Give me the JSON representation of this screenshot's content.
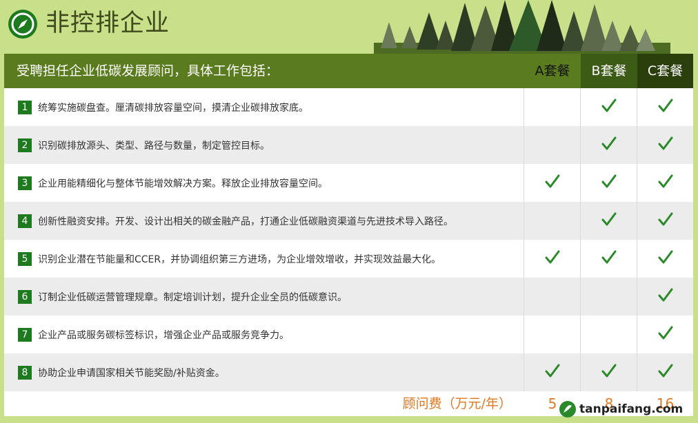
{
  "header": {
    "title": "非控排企业",
    "logo": "compass-icon"
  },
  "table": {
    "intro": "受聘担任企业低碳发展顾问，具体工作包括：",
    "packages": [
      "A套餐",
      "B套餐",
      "C套餐"
    ],
    "rows": [
      {
        "num": "1",
        "text": "统筹实施碳盘查。厘清碳排放容量空间，摸清企业碳排放家底。",
        "a": false,
        "b": true,
        "c": true
      },
      {
        "num": "2",
        "text": "识别碳排放源头、类型、路径与数量，制定管控目标。",
        "a": false,
        "b": true,
        "c": true
      },
      {
        "num": "3",
        "text": "企业用能精细化与整体节能增效解决方案。释放企业排放容量空间。",
        "a": true,
        "b": true,
        "c": true
      },
      {
        "num": "4",
        "text": "创新性融资安排。开发、设计出相关的碳金融产品，打通企业低碳融资渠道与先进技术导入路径。",
        "a": false,
        "b": true,
        "c": true
      },
      {
        "num": "5",
        "text": "识别企业潜在节能量和CCER，并协调组织第三方进场，为企业增效增收，并实现效益最大化。",
        "a": true,
        "b": true,
        "c": true
      },
      {
        "num": "6",
        "text": "订制企业低碳运营管理规章。制定培训计划，提升企业全员的低碳意识。",
        "a": false,
        "b": false,
        "c": true
      },
      {
        "num": "7",
        "text": "企业产品或服务碳标签标识，增强企业产品或服务竞争力。",
        "a": false,
        "b": false,
        "c": true
      },
      {
        "num": "8",
        "text": "协助企业申请国家相关节能奖励/补贴资金。",
        "a": true,
        "b": true,
        "c": true
      }
    ],
    "fee_label": "顾问费（万元/年）",
    "fees": [
      "5",
      "8",
      "16"
    ]
  },
  "watermark": {
    "text": "tanpaifang.com"
  },
  "colors": {
    "header_bar": "#5a7c1e",
    "check": "#2a8a2a",
    "fee": "#e07820",
    "background": "#c9e08a"
  }
}
